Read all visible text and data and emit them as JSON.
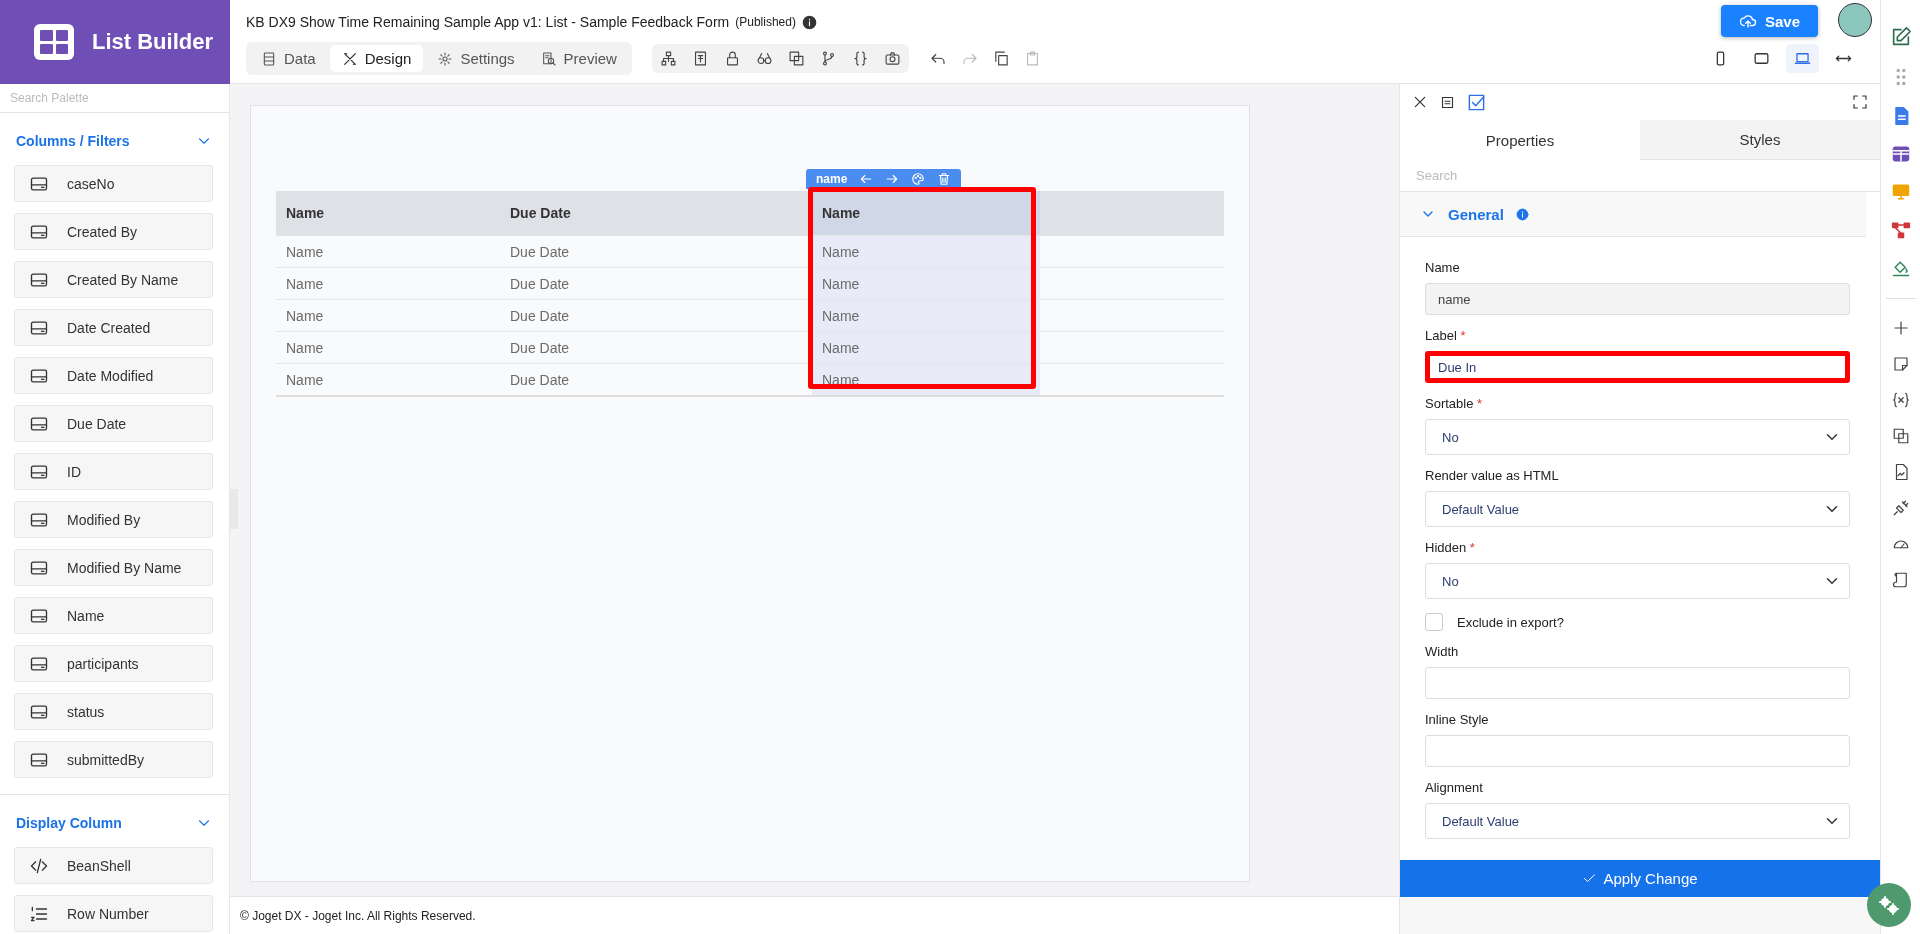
{
  "app": {
    "title": "List Builder"
  },
  "header": {
    "title": "KB DX9 Show Time Remaining Sample App v1: List - Sample Feedback Form",
    "status": "(Published)"
  },
  "tabs": [
    {
      "label": "Data",
      "selected": false
    },
    {
      "label": "Design",
      "selected": true
    },
    {
      "label": "Settings",
      "selected": false
    },
    {
      "label": "Preview",
      "selected": false
    }
  ],
  "devices": [
    {
      "selected": false
    },
    {
      "selected": false
    },
    {
      "selected": true
    },
    {
      "selected": false
    }
  ],
  "save_button": "Save",
  "palette": {
    "search_placeholder": "Search Palette",
    "sections": [
      {
        "title": "Columns / Filters",
        "expanded": true,
        "items": [
          {
            "label": "caseNo",
            "kind": "field"
          },
          {
            "label": "Created By",
            "kind": "field"
          },
          {
            "label": "Created By Name",
            "kind": "field"
          },
          {
            "label": "Date Created",
            "kind": "field"
          },
          {
            "label": "Date Modified",
            "kind": "field"
          },
          {
            "label": "Due Date",
            "kind": "field"
          },
          {
            "label": "ID",
            "kind": "field"
          },
          {
            "label": "Modified By",
            "kind": "field"
          },
          {
            "label": "Modified By Name",
            "kind": "field"
          },
          {
            "label": "Name",
            "kind": "field"
          },
          {
            "label": "participants",
            "kind": "field"
          },
          {
            "label": "status",
            "kind": "field"
          },
          {
            "label": "submittedBy",
            "kind": "field"
          }
        ]
      },
      {
        "title": "Display Column",
        "expanded": true,
        "items": [
          {
            "label": "BeanShell",
            "kind": "code"
          },
          {
            "label": "Row Number",
            "kind": "numbered"
          }
        ]
      }
    ]
  },
  "table": {
    "toolbar_label": "name",
    "columns": [
      {
        "label": "Name",
        "selected": false
      },
      {
        "label": "Due Date",
        "selected": false
      },
      {
        "label": "Name",
        "selected": true
      }
    ],
    "rows": [
      [
        "Name",
        "Due Date",
        "Name"
      ],
      [
        "Name",
        "Due Date",
        "Name"
      ],
      [
        "Name",
        "Due Date",
        "Name"
      ],
      [
        "Name",
        "Due Date",
        "Name"
      ],
      [
        "Name",
        "Due Date",
        "Name"
      ]
    ]
  },
  "properties": {
    "tabs": [
      {
        "label": "Properties",
        "selected": true
      },
      {
        "label": "Styles",
        "selected": false
      }
    ],
    "search_placeholder": "Search",
    "section": {
      "title": "General",
      "expanded": true
    },
    "fields": [
      {
        "kind": "text",
        "label": "Name",
        "value": "name",
        "disabled": true,
        "highlighted": false
      },
      {
        "kind": "text",
        "label": "Label",
        "required_mark": "*",
        "value": "Due In",
        "disabled": false,
        "highlighted": true
      },
      {
        "kind": "select",
        "label": "Sortable",
        "required_mark": "*",
        "value": "No"
      },
      {
        "kind": "select",
        "label": "Render value as HTML",
        "value": "Default Value"
      },
      {
        "kind": "select",
        "label": "Hidden",
        "required_mark": "*",
        "value": "No"
      },
      {
        "kind": "checkbox",
        "label": "Exclude in export?",
        "checked": false
      },
      {
        "kind": "text",
        "label": "Width",
        "disabled": false,
        "highlighted": false
      },
      {
        "kind": "text",
        "label": "Inline Style",
        "disabled": false,
        "highlighted": false
      },
      {
        "kind": "select",
        "label": "Alignment",
        "value": "Default Value"
      }
    ],
    "apply_button": "Apply Change"
  },
  "footer": "© Joget DX - Joget Inc. All Rights Reserved."
}
